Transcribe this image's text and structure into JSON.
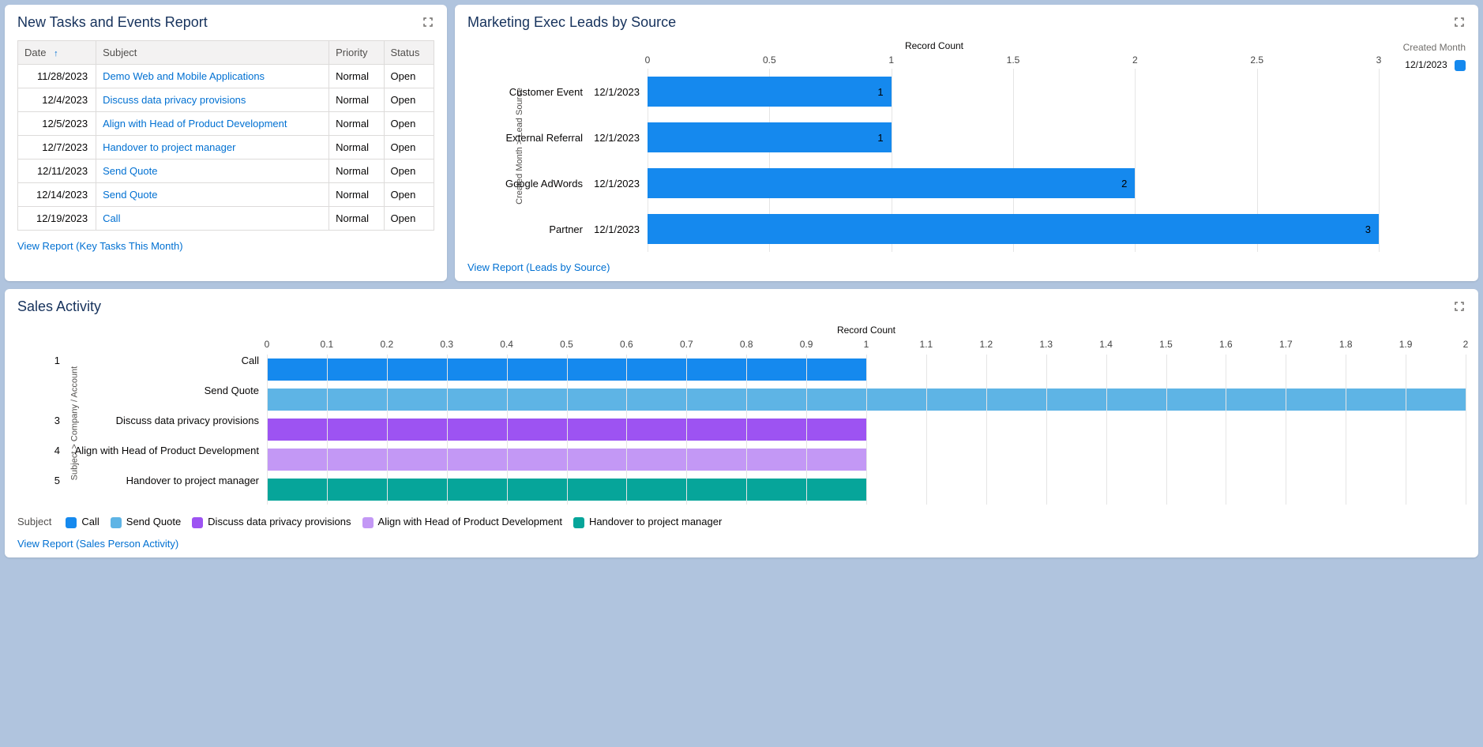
{
  "tasks": {
    "title": "New Tasks and Events Report",
    "columns": {
      "date": "Date",
      "subject": "Subject",
      "priority": "Priority",
      "status": "Status"
    },
    "rows": [
      {
        "date": "11/28/2023",
        "subject": "Demo Web and Mobile Applications",
        "priority": "Normal",
        "status": "Open"
      },
      {
        "date": "12/4/2023",
        "subject": "Discuss data privacy provisions",
        "priority": "Normal",
        "status": "Open"
      },
      {
        "date": "12/5/2023",
        "subject": "Align with Head of Product Development",
        "priority": "Normal",
        "status": "Open"
      },
      {
        "date": "12/7/2023",
        "subject": "Handover to project manager",
        "priority": "Normal",
        "status": "Open"
      },
      {
        "date": "12/11/2023",
        "subject": "Send Quote",
        "priority": "Normal",
        "status": "Open"
      },
      {
        "date": "12/14/2023",
        "subject": "Send Quote",
        "priority": "Normal",
        "status": "Open"
      },
      {
        "date": "12/19/2023",
        "subject": "Call",
        "priority": "Normal",
        "status": "Open"
      }
    ],
    "view_report": "View Report (Key Tasks This Month)"
  },
  "marketing": {
    "title": "Marketing Exec Leads by Source",
    "x_title": "Record Count",
    "y_title": "Created Month  >  Lead Source",
    "legend_header": "Created Month",
    "legend_item": "12/1/2023",
    "view_report": "View Report (Leads by Source)"
  },
  "sales": {
    "title": "Sales Activity",
    "x_title": "Record Count",
    "y_title": "Subject  >  Company / Account",
    "legend_header": "Subject",
    "view_report": "View Report (Sales Person Activity)"
  },
  "chart_data": [
    {
      "id": "marketing_leads",
      "type": "bar",
      "orientation": "horizontal",
      "title": "Marketing Exec Leads by Source",
      "xlabel": "Record Count",
      "ylabel": "Created Month > Lead Source",
      "xlim": [
        0,
        3
      ],
      "x_ticks": [
        0,
        0.5,
        1,
        1.5,
        2,
        2.5,
        3
      ],
      "categories": [
        "Customer Event",
        "External Referral",
        "Google AdWords",
        "Partner"
      ],
      "group_label": "12/1/2023",
      "values": [
        1,
        1,
        2,
        3
      ],
      "series_color": "#1589ee",
      "legend": {
        "header": "Created Month",
        "items": [
          "12/1/2023"
        ]
      }
    },
    {
      "id": "sales_activity",
      "type": "bar",
      "orientation": "horizontal",
      "title": "Sales Activity",
      "xlabel": "Record Count",
      "ylabel": "Subject > Company / Account",
      "xlim": [
        0,
        2
      ],
      "x_ticks": [
        0,
        0.1,
        0.2,
        0.3,
        0.4,
        0.5,
        0.6,
        0.7,
        0.8,
        0.9,
        1,
        1.1,
        1.2,
        1.3,
        1.4,
        1.5,
        1.6,
        1.7,
        1.8,
        1.9,
        2
      ],
      "groups": [
        {
          "id": "1",
          "rows": [
            {
              "subject": "Call",
              "value": 1,
              "color": "#1589ee"
            },
            {
              "subject": "Send Quote",
              "value": 2,
              "color": "#5eb4e5"
            }
          ]
        },
        {
          "id": "3",
          "rows": [
            {
              "subject": "Discuss data privacy provisions",
              "value": 1,
              "color": "#9d53f2"
            }
          ]
        },
        {
          "id": "4",
          "rows": [
            {
              "subject": "Align with Head of Product Development",
              "value": 1,
              "color": "#c398f5"
            }
          ]
        },
        {
          "id": "5",
          "rows": [
            {
              "subject": "Handover to project manager",
              "value": 1,
              "color": "#06a59a"
            }
          ]
        }
      ],
      "legend": {
        "header": "Subject",
        "items": [
          {
            "label": "Call",
            "color": "#1589ee"
          },
          {
            "label": "Send Quote",
            "color": "#5eb4e5"
          },
          {
            "label": "Discuss data privacy provisions",
            "color": "#9d53f2"
          },
          {
            "label": "Align with Head of Product Development",
            "color": "#c398f5"
          },
          {
            "label": "Handover to project manager",
            "color": "#06a59a"
          }
        ]
      }
    }
  ]
}
